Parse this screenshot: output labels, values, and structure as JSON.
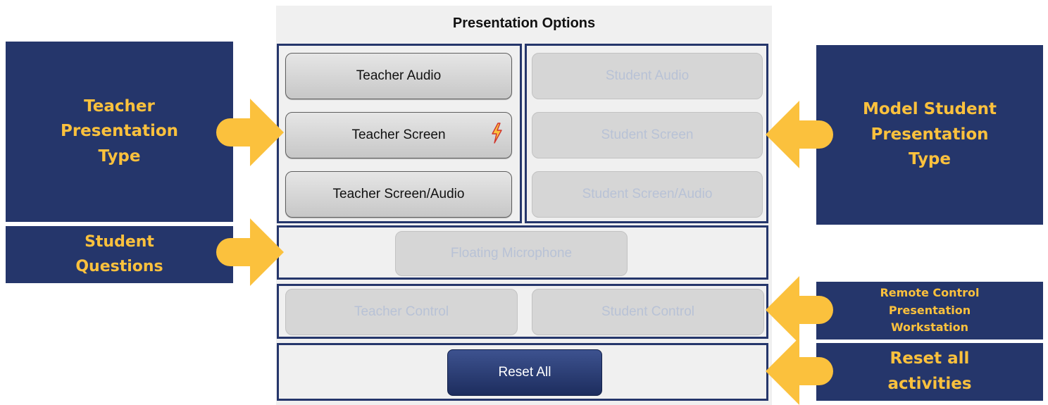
{
  "panel": {
    "title": "Presentation Options",
    "teacher_buttons": {
      "audio": "Teacher Audio",
      "screen": "Teacher Screen",
      "screen_audio": "Teacher Screen/Audio"
    },
    "student_buttons": {
      "audio": "Student Audio",
      "screen": "Student Screen",
      "screen_audio": "Student Screen/Audio"
    },
    "floating_microphone": "Floating Microphone",
    "control_buttons": {
      "teacher": "Teacher Control",
      "student": "Student Control"
    },
    "reset_all": "Reset All",
    "lightning_icon": "lightning-icon"
  },
  "callouts": {
    "teacher_presentation_type": [
      "Teacher",
      "Presentation",
      "Type"
    ],
    "model_student_presentation_type": [
      "Model Student",
      "Presentation",
      "Type"
    ],
    "student_questions": [
      "Student",
      "Questions"
    ],
    "remote_control_workstation": [
      "Remote Control",
      "Presentation",
      "Workstation"
    ],
    "reset_all_activities": [
      "Reset all",
      "activities"
    ]
  },
  "colors": {
    "callout_background": "#25366b",
    "callout_text": "#fbc13d",
    "arrow": "#fbc13d",
    "group_border": "#25366b",
    "panel_background": "#f0f0f0",
    "disabled_text": "#b8c2d6"
  }
}
